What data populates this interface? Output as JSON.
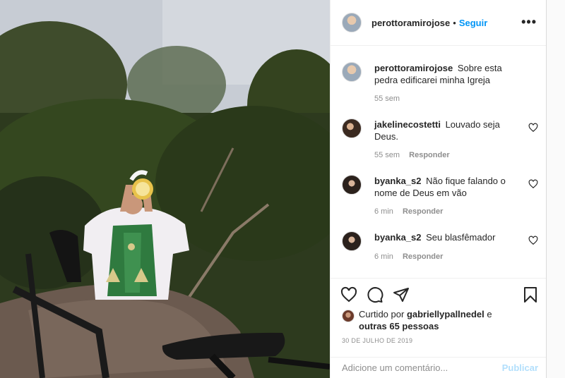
{
  "post": {
    "photo_icon": "priest-raising-host-photo",
    "author": "perottoramirojose",
    "separator": "•",
    "follow_label": "Seguir",
    "more_icon": "more-options-icon",
    "caption": {
      "user": "perottoramirojose",
      "text": "Sobre esta pedra edificarei minha Igreja",
      "time": "55 sem"
    }
  },
  "comments": [
    {
      "user": "jakelinecostetti",
      "text": "Louvado seja Deus.",
      "time": "55 sem",
      "reply": "Responder"
    },
    {
      "user": "byanka_s2",
      "text": "Não fique falando o nome de Deus em vão",
      "time": "6 min",
      "reply": "Responder"
    },
    {
      "user": "byanka_s2",
      "text": "Seu blasfêmador",
      "time": "6 min",
      "reply": "Responder"
    }
  ],
  "likes": {
    "prefix": "Curtido por",
    "user": "gabriellypallnedel",
    "suffix": "e",
    "others": "outras 65 pessoas"
  },
  "date": "30 DE JULHO DE 2019",
  "add_comment": {
    "placeholder": "Adicione um comentário...",
    "publish_label": "Publicar"
  },
  "colors": {
    "link_blue": "#0095f6",
    "publish_disabled": "#b2dffc",
    "muted": "#8e8e8e"
  }
}
